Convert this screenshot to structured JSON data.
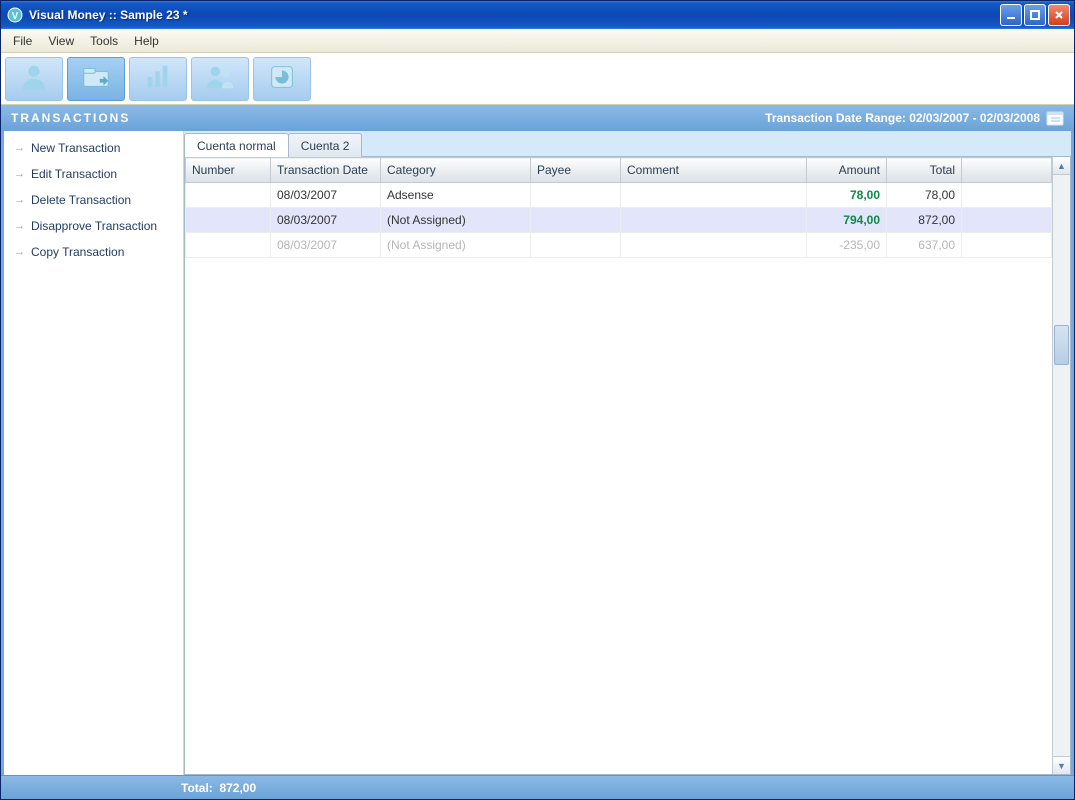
{
  "window": {
    "title": "Visual Money :: Sample 23 *"
  },
  "menu": {
    "items": [
      "File",
      "View",
      "Tools",
      "Help"
    ]
  },
  "section": {
    "title": "TRANSACTIONS",
    "range_label": "Transaction Date Range: 02/03/2007 - 02/03/2008"
  },
  "sidebar": {
    "items": [
      {
        "label": "New Transaction"
      },
      {
        "label": "Edit Transaction"
      },
      {
        "label": "Delete Transaction"
      },
      {
        "label": "Disapprove Transaction"
      },
      {
        "label": "Copy Transaction"
      }
    ]
  },
  "tabs": [
    {
      "label": "Cuenta normal",
      "active": true
    },
    {
      "label": "Cuenta 2",
      "active": false
    }
  ],
  "grid": {
    "columns": [
      "Number",
      "Transaction Date",
      "Category",
      "Payee",
      "Comment",
      "Amount",
      "Total"
    ],
    "rows": [
      {
        "number": "",
        "date": "08/03/2007",
        "category": "Adsense",
        "payee": "",
        "comment": "",
        "amount": "78,00",
        "amount_sign": "pos",
        "total": "78,00",
        "style": "normal"
      },
      {
        "number": "",
        "date": "08/03/2007",
        "category": "(Not Assigned)",
        "payee": "",
        "comment": "",
        "amount": "794,00",
        "amount_sign": "pos",
        "total": "872,00",
        "style": "alt"
      },
      {
        "number": "",
        "date": "08/03/2007",
        "category": "(Not Assigned)",
        "payee": "",
        "comment": "",
        "amount": "-235,00",
        "amount_sign": "neg",
        "total": "637,00",
        "style": "faded"
      }
    ]
  },
  "status": {
    "total_label": "Total:",
    "total_value": "872,00"
  }
}
